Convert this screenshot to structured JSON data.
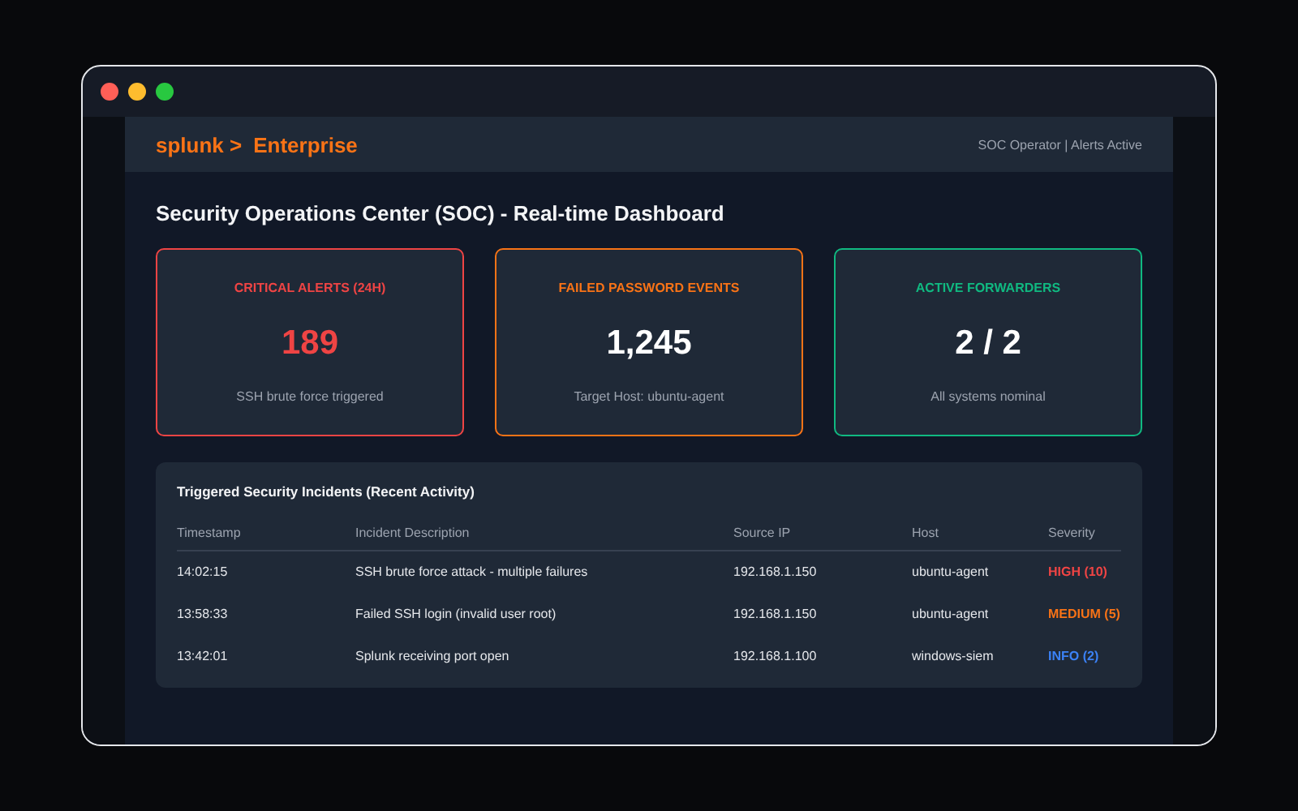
{
  "window": {
    "controls": [
      {
        "kind": "close"
      },
      {
        "kind": "minimize"
      },
      {
        "kind": "maximize"
      }
    ]
  },
  "header": {
    "brand": "splunk >",
    "product": "Enterprise",
    "status": "SOC Operator | Alerts Active"
  },
  "page_title": "Security Operations Center (SOC) - Real-time Dashboard",
  "cards": [
    {
      "title": "CRITICAL ALERTS (24H)",
      "value": "189",
      "note": "SSH brute force triggered",
      "color": "#ef4444",
      "value_colored": true
    },
    {
      "title": "FAILED PASSWORD EVENTS",
      "value": "1,245",
      "note": "Target Host: ubuntu-agent",
      "color": "#f97316",
      "value_colored": false
    },
    {
      "title": "ACTIVE FORWARDERS",
      "value": "2 / 2",
      "note": "All systems nominal",
      "color": "#10b981",
      "value_colored": false
    }
  ],
  "table": {
    "title": "Triggered Security Incidents (Recent Activity)",
    "columns": [
      "Timestamp",
      "Incident Description",
      "Source IP",
      "Host",
      "Severity"
    ],
    "rows": [
      {
        "cells": [
          "14:02:15",
          "SSH brute force attack - multiple failures",
          "192.168.1.150",
          "ubuntu-agent"
        ],
        "severity": "HIGH (10)",
        "color": "#ef4444"
      },
      {
        "cells": [
          "13:58:33",
          "Failed SSH login (invalid user root)",
          "192.168.1.150",
          "ubuntu-agent"
        ],
        "severity": "MEDIUM (5)",
        "color": "#f97316"
      },
      {
        "cells": [
          "13:42:01",
          "Splunk receiving port open",
          "192.168.1.100",
          "windows-siem"
        ],
        "severity": "INFO (2)",
        "color": "#3b82f6"
      }
    ]
  }
}
